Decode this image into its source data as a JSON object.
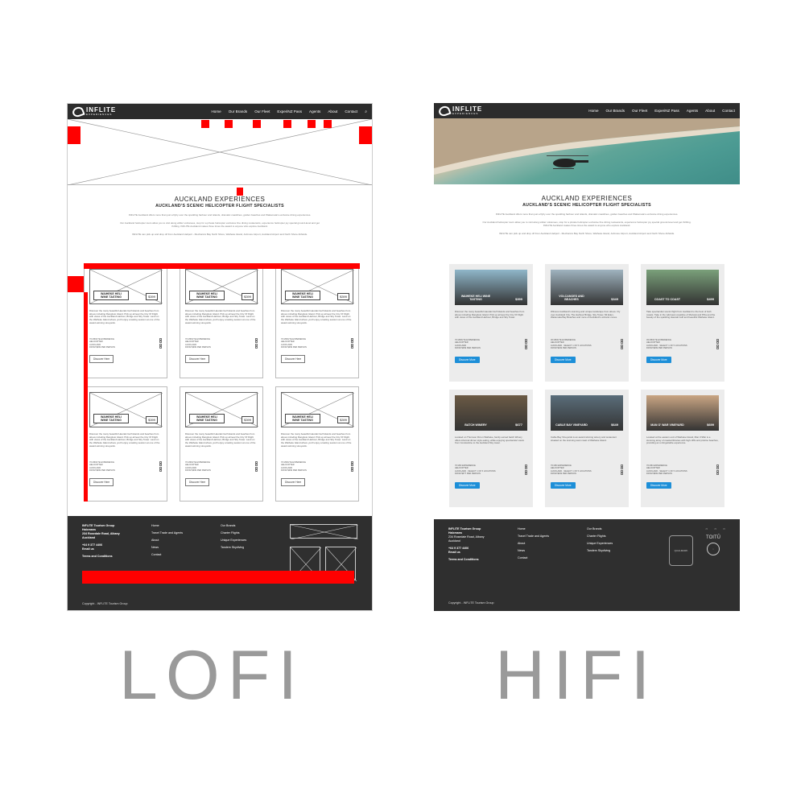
{
  "nav": {
    "logo_main": "INFLITE",
    "logo_sub": "EXPERIENCES",
    "items": [
      "Home",
      "Our Brands",
      "Our Fleet",
      "ExperiNZ Pass",
      "Agents",
      "About",
      "Contact"
    ]
  },
  "intro": {
    "title": "AUCKLAND EXPERIENCES",
    "subtitle": "AUCKLAND'S SCENIC HELICOPTER FLIGHT SPECIALISTS",
    "p1": "INFLITE Auckland offers more than just a flyby over the sparkling harbour and islands, dramatic coastlines, golden beaches and Waitemata's exclusive dining experiences.",
    "p2": "Our Auckland helicopter tours allow you to visit along wilder volcanoes, stop for a private helicopter exclusive fine dining restaurants, experience helicopter joy special ground-level and get thrilling. INFLITE Auckland makes three times the award to anyone who explore Auckland.",
    "p3": "INFLITE can pick up and drop off from Auckland Heliport - Mechanics Bay North Shore, Waiheke Island, Ardmore Airport, Auckland Airport and North Shore Airfields."
  },
  "lofi_cards": [
    {
      "title": "WAIHEKE HELI WINE TASTING",
      "price": "$399",
      "desc": "Discover the many beautiful Hauraki Gulf islands and beaches from above including Rangitoto Island. Pick up at/near the City Of Flight with views of the Auckland Harbour, Bridge and Sky Tower. Land on the Waiheke Island where you'll enjoy a tasting session at one of the award-winning vineyards.",
      "meta": [
        "70 MINUTE EXPERIENCE",
        "HELICOPTER",
        "AUCKLAND",
        "FROM $399 PER PERSON"
      ],
      "btn": "Discover Here"
    },
    {
      "title": "WAIHEKE HELI WINE TASTING",
      "price": "$399",
      "desc": "Discover the many beautiful Hauraki Gulf islands and beaches from above including Rangitoto Island. Pick up at/near the City Of Flight with views of the Auckland Harbour, Bridge and Sky Tower. Land on the Waiheke Island where you'll enjoy a tasting session at one of the award-winning vineyards.",
      "meta": [
        "70 MINUTE EXPERIENCE",
        "HELICOPTER",
        "AUCKLAND",
        "FROM $399 PER PERSON"
      ],
      "btn": "Discover Here"
    },
    {
      "title": "WAIHEKE HELI WINE TASTING",
      "price": "$399",
      "desc": "Discover the many beautiful Hauraki Gulf islands and beaches from above including Rangitoto Island. Pick up at/near the City Of Flight with views of the Auckland Harbour, Bridge and Sky Tower. Land on the Waiheke Island where you'll enjoy a tasting session at one of the award-winning vineyards.",
      "meta": [
        "70 MINUTE EXPERIENCE",
        "HELICOPTER",
        "AUCKLAND",
        "FROM $399 PER PERSON"
      ],
      "btn": "Discover Here"
    },
    {
      "title": "WAIHEKE HELI WINE TASTING",
      "price": "$399",
      "desc": "Discover the many beautiful Hauraki Gulf islands and beaches from above including Rangitoto Island. Pick up at/near the City Of Flight with views of the Auckland Harbour, Bridge and Sky Tower. Land on the Waiheke Island where you'll enjoy a tasting session at one of the award-winning vineyards.",
      "meta": [
        "70 MINUTE EXPERIENCE",
        "HELICOPTER",
        "AUCKLAND",
        "FROM $399 PER PERSON"
      ],
      "btn": "Discover Here"
    },
    {
      "title": "WAIHEKE HELI WINE TASTING",
      "price": "$399",
      "desc": "Discover the many beautiful Hauraki Gulf islands and beaches from above including Rangitoto Island. Pick up at/near the City Of Flight with views of the Auckland Harbour, Bridge and Sky Tower. Land on the Waiheke Island where you'll enjoy a tasting session at one of the award-winning vineyards.",
      "meta": [
        "70 MINUTE EXPERIENCE",
        "HELICOPTER",
        "AUCKLAND",
        "FROM $399 PER PERSON"
      ],
      "btn": "Discover Here"
    },
    {
      "title": "WAIHEKE HELI WINE TASTING",
      "price": "$399",
      "desc": "Discover the many beautiful Hauraki Gulf islands and beaches from above including Rangitoto Island. Pick up at/near the City Of Flight with views of the Auckland Harbour, Bridge and Sky Tower. Land on the Waiheke Island where you'll enjoy a tasting session at one of the award-winning vineyards.",
      "meta": [
        "70 MINUTE EXPERIENCE",
        "HELICOPTER",
        "AUCKLAND",
        "FROM $399 PER PERSON"
      ],
      "btn": "Discover Here"
    }
  ],
  "hifi_cards": [
    {
      "title": "WAIHEKE HELI WINE TASTING",
      "price": "$399",
      "img": "#8fb6c9",
      "desc": "Discover the many beautiful Hauraki Gulf islands and beaches from above including Rangitoto Island. Pick up at/near the City Of Flight with views of the Auckland Harbour, Bridge and Sky Tower.",
      "meta": [
        "70 MINUTE EXPERIENCE",
        "HELICOPTER",
        "AUCKLAND",
        "FROM $399 PER PERSON"
      ],
      "btn": "Discover More"
    },
    {
      "title": "VOLCANOES AND BEACHES",
      "price": "$349",
      "img": "#9fb3bf",
      "desc": "Witness Auckland's stunning and unique landscape from above. Fly over Auckland City, The Harbour Bridge, Sky Tower, Mt Eden, Waitemata Bay Beaches and more of Auckland's volcanic cones.",
      "meta": [
        "30 MINUTE EXPERIENCE",
        "HELICOPTER",
        "AUCKLAND - SELECT 1 OF 5 LOCATIONS",
        "FROM $349 PER PERSON"
      ],
      "btn": "Discover More"
    },
    {
      "title": "COAST TO COAST",
      "price": "$499",
      "img": "#7aa07a",
      "desc": "Take spectacular scenic flight from Auckland to the best of both coasts. Take in the wild west coastline of Muriwai and Piha and the beauty of the sparkling Hauraki Gulf and beautiful Waiheke Island.",
      "meta": [
        "45 MINUTE EXPERIENCE",
        "HELICOPTER",
        "AUCKLAND - SELECT 1 OF 5 LOCATIONS",
        "FROM $499 PER PERSON"
      ],
      "btn": "Discover More"
    },
    {
      "title": "BATCH WINERY",
      "price": "$677",
      "img": "#6b5a45",
      "desc": "Located on Thomson Rd on Waiheke, family owned batch Winery offers informal dinner style eating, while enjoying spectacular views from Constantine to the Auckland Sky tower.",
      "meta": [
        "70 MIN EXPERIENCE",
        "HELICOPTER",
        "AUCKLAND - SELECT 1 OF 5 LOCATIONS",
        "FROM $677 PER PERSON"
      ],
      "btn": "Discover More"
    },
    {
      "title": "CABLE BAY VINEYARD",
      "price": "$649",
      "img": "#5a6d7a",
      "desc": "Cable Bay Vineyards is an award winning winery and restaurant situated on the stunning west coast of Waiheke Island.",
      "meta": [
        "70 MIN EXPERIENCE",
        "HELICOPTER",
        "AUCKLAND - SELECT 1 OF 5 LOCATIONS",
        "FROM $649 PER PERSON"
      ],
      "btn": "Discover More"
    },
    {
      "title": "MAN O' WAR VINEYARD",
      "price": "$699",
      "img": "#c9a583",
      "desc": "Located at the eastern end of Waiheke Island, Man O'War is a stunning array of coastal libraries with high cliffs and pristine beaches, providing an unforgettable experience.",
      "meta": [
        "70 MIN EXPERIENCE",
        "HELICOPTER",
        "AUCKLAND - SELECT 1 OF 5 LOCATIONS",
        "FROM $699 PER PERSON"
      ],
      "btn": "Discover More"
    }
  ],
  "footer": {
    "col1": [
      "INFLITE Tourism Group",
      "Halcmans",
      "234 Rosedale Road, Albany",
      "Auckland",
      "+64 9 377 4406",
      "Email us",
      "Terms and Conditions"
    ],
    "col2": [
      "Home",
      "Travel Trade and Agents",
      "About",
      "News",
      "Contact"
    ],
    "col3": [
      "Our Brands",
      "Charter Flights",
      "Unique Experiences",
      "Tandem Skydiving"
    ],
    "copyright": "Copyright - INFLITE Tourism Group",
    "logos": [
      "QUALMARK",
      "TOITŪ"
    ]
  },
  "labels": {
    "lofi": "LOFI",
    "hifi": "HIFI"
  },
  "colors": {
    "accent": "#1d8fd8",
    "wire_red": "#ff0000",
    "dark": "#2f2f2f"
  }
}
